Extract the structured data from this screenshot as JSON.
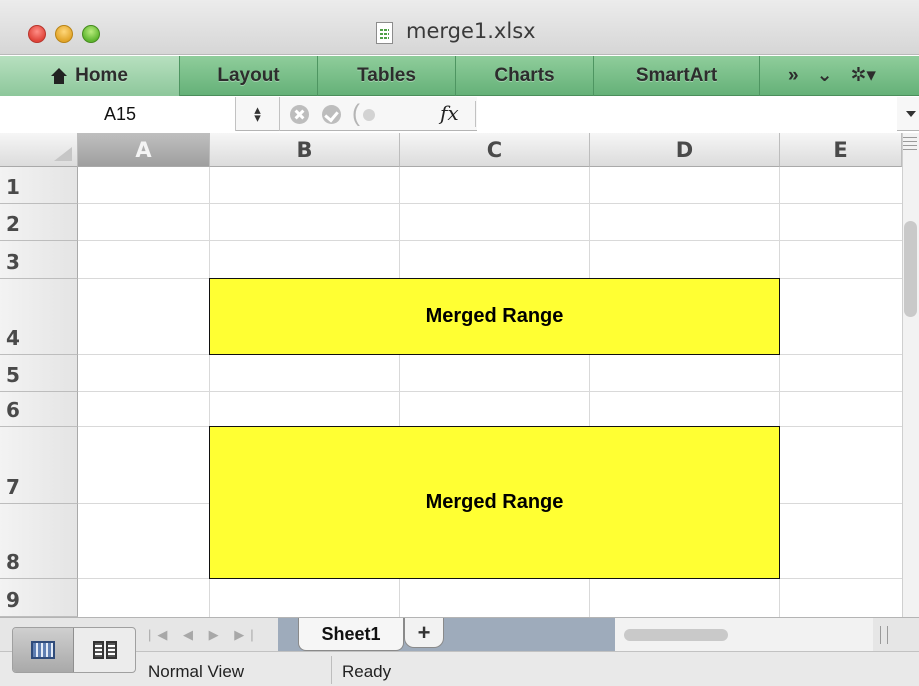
{
  "window": {
    "title": "merge1.xlsx"
  },
  "ribbon": {
    "tabs": [
      {
        "label": "Home",
        "width": 180
      },
      {
        "label": "Layout",
        "width": 138
      },
      {
        "label": "Tables",
        "width": 138
      },
      {
        "label": "Charts",
        "width": 138
      },
      {
        "label": "SmartArt",
        "width": 166
      }
    ],
    "more_label": "»",
    "collapse_label": "⌄",
    "gear_label": "✲▾"
  },
  "formula_bar": {
    "name_box": "A15",
    "fx_label": "fx",
    "formula_value": ""
  },
  "sheet": {
    "columns": [
      "A",
      "B",
      "C",
      "D",
      "E"
    ],
    "selected_column": "A",
    "rows": [
      "1",
      "2",
      "3",
      "4",
      "5",
      "6",
      "7",
      "8",
      "9"
    ],
    "merged_ranges": [
      {
        "range": "B4:D4",
        "text": "Merged Range"
      },
      {
        "range": "B7:D8",
        "text": "Merged Range"
      }
    ],
    "fill_color": "#FFFF33"
  },
  "tabs_bar": {
    "sheet_name": "Sheet1",
    "add_label": "+"
  },
  "status": {
    "view": "Normal View",
    "state": "Ready"
  }
}
